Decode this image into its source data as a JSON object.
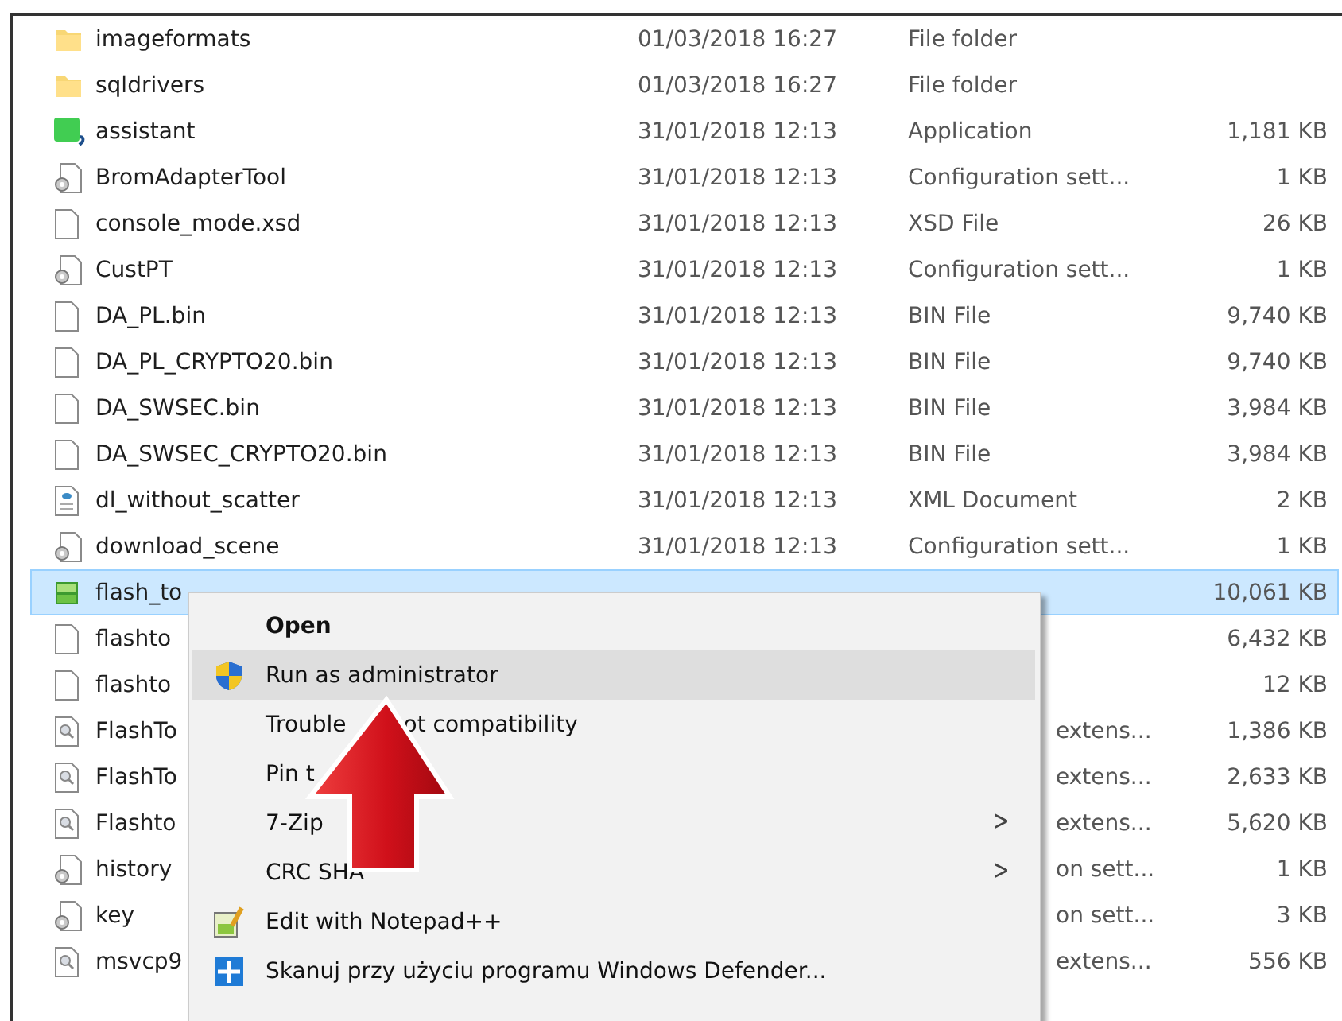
{
  "files": [
    {
      "name": "imageformats",
      "date": "01/03/2018 16:27",
      "type": "File folder",
      "kind": "folder",
      "selected": false
    },
    {
      "name": "sqldrivers",
      "date": "01/03/2018 16:27",
      "type": "File folder",
      "kind": "folder",
      "selected": false
    },
    {
      "name": "assistant",
      "date": "31/01/2018 12:13",
      "type": "Application",
      "size": "1,181 KB",
      "kind": "qt",
      "selected": false
    },
    {
      "name": "BromAdapterTool",
      "date": "31/01/2018 12:13",
      "type": "Configuration sett...",
      "size": "1 KB",
      "kind": "config",
      "selected": false
    },
    {
      "name": "console_mode.xsd",
      "date": "31/01/2018 12:13",
      "type": "XSD File",
      "size": "26 KB",
      "kind": "file",
      "selected": false
    },
    {
      "name": "CustPT",
      "date": "31/01/2018 12:13",
      "type": "Configuration sett...",
      "size": "1 KB",
      "kind": "config",
      "selected": false
    },
    {
      "name": "DA_PL.bin",
      "date": "31/01/2018 12:13",
      "type": "BIN File",
      "size": "9,740 KB",
      "kind": "file",
      "selected": false
    },
    {
      "name": "DA_PL_CRYPTO20.bin",
      "date": "31/01/2018 12:13",
      "type": "BIN File",
      "size": "9,740 KB",
      "kind": "file",
      "selected": false
    },
    {
      "name": "DA_SWSEC.bin",
      "date": "31/01/2018 12:13",
      "type": "BIN File",
      "size": "3,984 KB",
      "kind": "file",
      "selected": false
    },
    {
      "name": "DA_SWSEC_CRYPTO20.bin",
      "date": "31/01/2018 12:13",
      "type": "BIN File",
      "size": "3,984 KB",
      "kind": "file",
      "selected": false
    },
    {
      "name": "dl_without_scatter",
      "date": "31/01/2018 12:13",
      "type": "XML Document",
      "size": "2 KB",
      "kind": "xml",
      "selected": false
    },
    {
      "name": "download_scene",
      "date": "31/01/2018 12:13",
      "type": "Configuration sett...",
      "size": "1 KB",
      "kind": "config",
      "selected": false
    },
    {
      "name": "flash_to",
      "size": "10,061 KB",
      "kind": "app",
      "selected": true
    },
    {
      "name": "flashto",
      "size": "6,432 KB",
      "kind": "file",
      "selected": false
    },
    {
      "name": "flashto",
      "size": "12 KB",
      "kind": "file",
      "selected": false
    },
    {
      "name": "FlashTo",
      "type": "extens...",
      "size": "1,386 KB",
      "kind": "dll",
      "selected": false
    },
    {
      "name": "FlashTo",
      "type": "extens...",
      "size": "2,633 KB",
      "kind": "dll",
      "selected": false
    },
    {
      "name": "Flashto",
      "type": "extens...",
      "size": "5,620 KB",
      "kind": "dll",
      "selected": false
    },
    {
      "name": "history",
      "type": "on sett...",
      "size": "1 KB",
      "kind": "config",
      "selected": false
    },
    {
      "name": "key",
      "type": "on sett...",
      "size": "3 KB",
      "kind": "config",
      "selected": false
    },
    {
      "name": "msvcp9",
      "type": "extens...",
      "size": "556 KB",
      "kind": "dll",
      "selected": false
    }
  ],
  "context_menu": [
    {
      "label": "Open",
      "kind": "plain",
      "default": true,
      "selected": false
    },
    {
      "label": "Run as administrator",
      "kind": "shield",
      "default": false,
      "selected": true
    },
    {
      "label": "Trouble",
      "label_after": "ot compatibility",
      "kind": "plain",
      "default": false,
      "selected": false
    },
    {
      "label": "Pin t",
      "kind": "plain",
      "default": false,
      "selected": false
    },
    {
      "label": "7-Zip",
      "kind": "plain",
      "default": false,
      "submenu": true,
      "submenu_glyph": ">",
      "selected": false
    },
    {
      "label": "CRC SHA",
      "kind": "plain",
      "default": false,
      "submenu": true,
      "submenu_glyph": ">",
      "selected": false
    },
    {
      "label": "Edit with Notepad++",
      "kind": "notepad",
      "default": false,
      "selected": false
    },
    {
      "label": "Skanuj przy użyciu programu Windows Defender...",
      "kind": "defender",
      "default": false,
      "selected": false
    }
  ]
}
